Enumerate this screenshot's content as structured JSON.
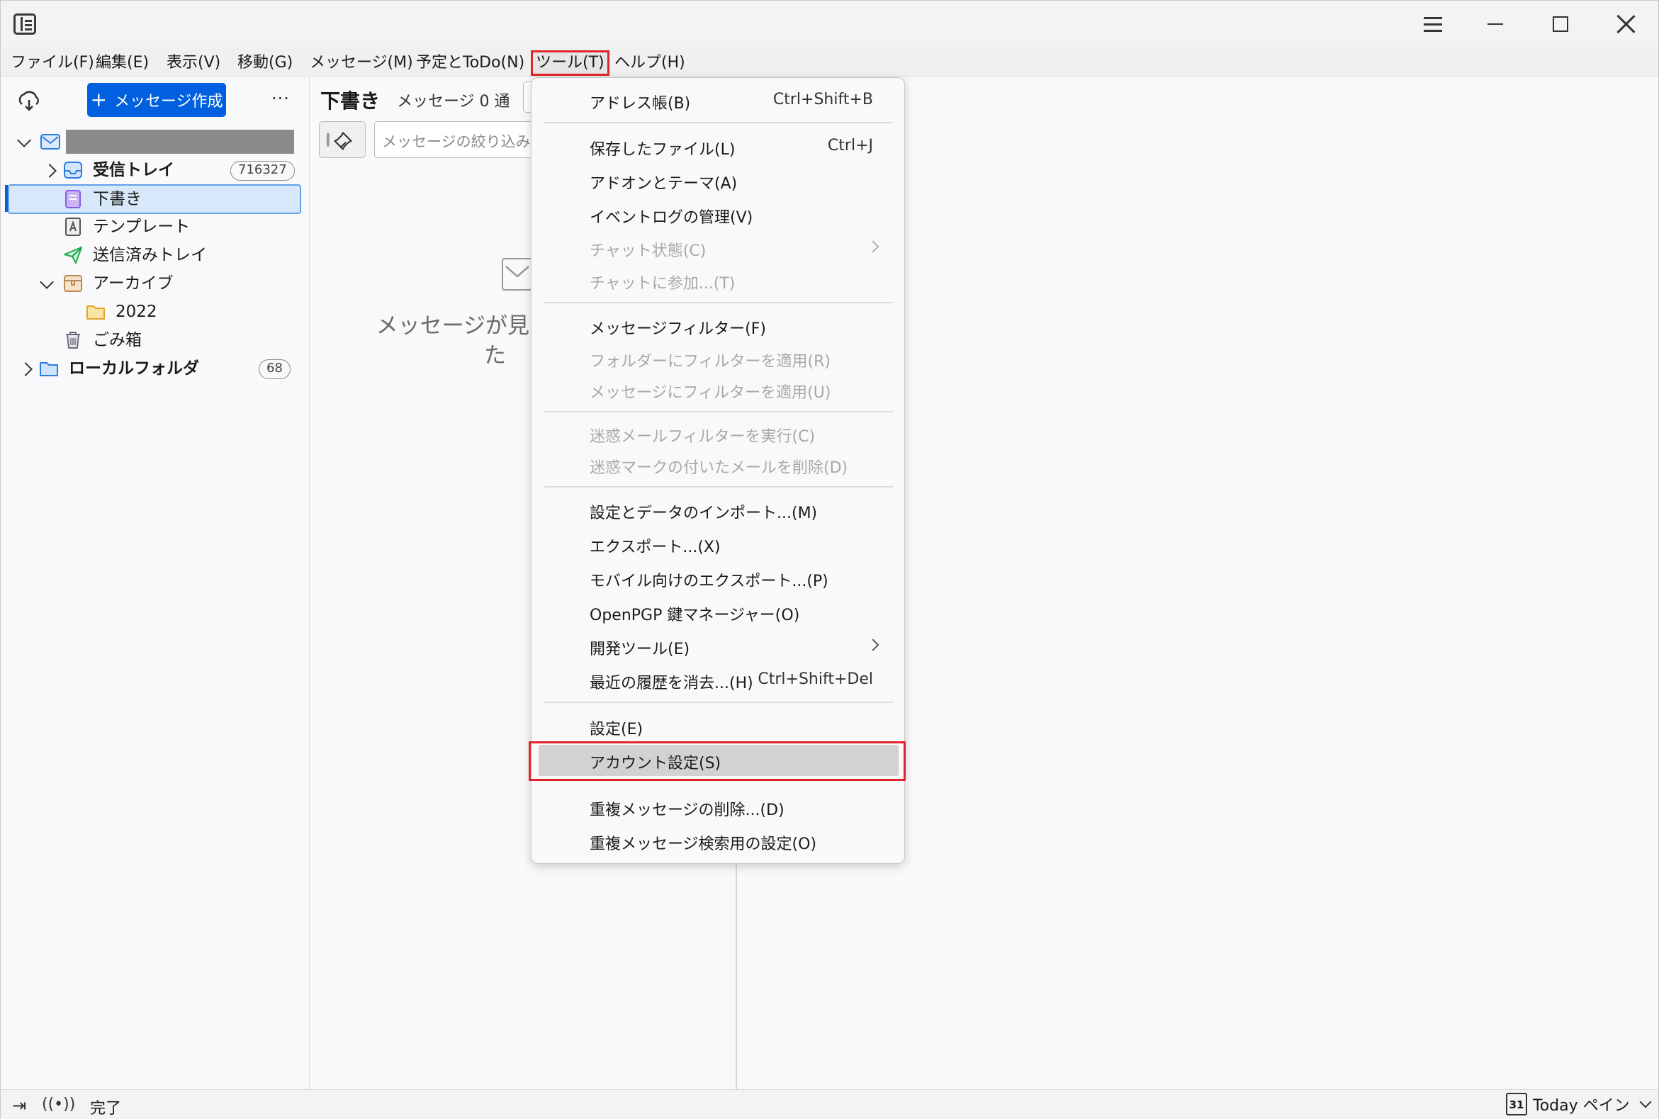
{
  "menubar": {
    "items": [
      "ファイル(F)",
      "編集(E)",
      "表示(V)",
      "移動(G)",
      "メッセージ(M)",
      "予定とToDo(N)",
      "ツール(T)",
      "ヘルプ(H)"
    ]
  },
  "folderpane": {
    "compose_label": "メッセージ作成",
    "folders": {
      "inbox": {
        "label": "受信トレイ",
        "count": "716327"
      },
      "drafts": {
        "label": "下書き"
      },
      "templates": {
        "label": "テンプレート"
      },
      "sent": {
        "label": "送信済みトレイ"
      },
      "archive": {
        "label": "アーカイブ"
      },
      "archive_2022": {
        "label": "2022"
      },
      "trash": {
        "label": "ごみ箱"
      },
      "local": {
        "label": "ローカルフォルダ",
        "count": "68"
      }
    }
  },
  "threadpane": {
    "title": "下書き",
    "count": "メッセージ 0 通",
    "search_placeholder": "メッセージの絞り込み...",
    "empty_line1": "メッセージが見つ",
    "empty_line2": "た"
  },
  "statusbar": {
    "status": "完了",
    "calendar_day": "31",
    "today_pane": "Today ペイン"
  },
  "tools_menu": {
    "items": [
      {
        "label": "アドレス帳(B)",
        "shortcut": "Ctrl+Shift+B"
      },
      {
        "label": "保存したファイル(L)",
        "shortcut": "Ctrl+J"
      },
      {
        "label": "アドオンとテーマ(A)"
      },
      {
        "label": "イベントログの管理(V)"
      },
      {
        "label": "チャット状態(C)"
      },
      {
        "label": "チャットに参加...(T)"
      },
      {
        "label": "メッセージフィルター(F)"
      },
      {
        "label": "フォルダーにフィルターを適用(R)"
      },
      {
        "label": "メッセージにフィルターを適用(U)"
      },
      {
        "label": "迷惑メールフィルターを実行(C)"
      },
      {
        "label": "迷惑マークの付いたメールを削除(D)"
      },
      {
        "label": "設定とデータのインポート...(M)"
      },
      {
        "label": "エクスポート...(X)"
      },
      {
        "label": "モバイル向けのエクスポート...(P)"
      },
      {
        "label": "OpenPGP 鍵マネージャー(O)"
      },
      {
        "label": "開発ツール(E)"
      },
      {
        "label": "最近の履歴を消去...(H)",
        "shortcut": "Ctrl+Shift+Del"
      },
      {
        "label": "設定(E)"
      },
      {
        "label": "アカウント設定(S)"
      },
      {
        "label": "重複メッセージの削除...(D)"
      },
      {
        "label": "重複メッセージ検索用の設定(O)"
      }
    ]
  },
  "colors": {
    "accent": "#0060df",
    "highlight_box": "#e0242b"
  }
}
